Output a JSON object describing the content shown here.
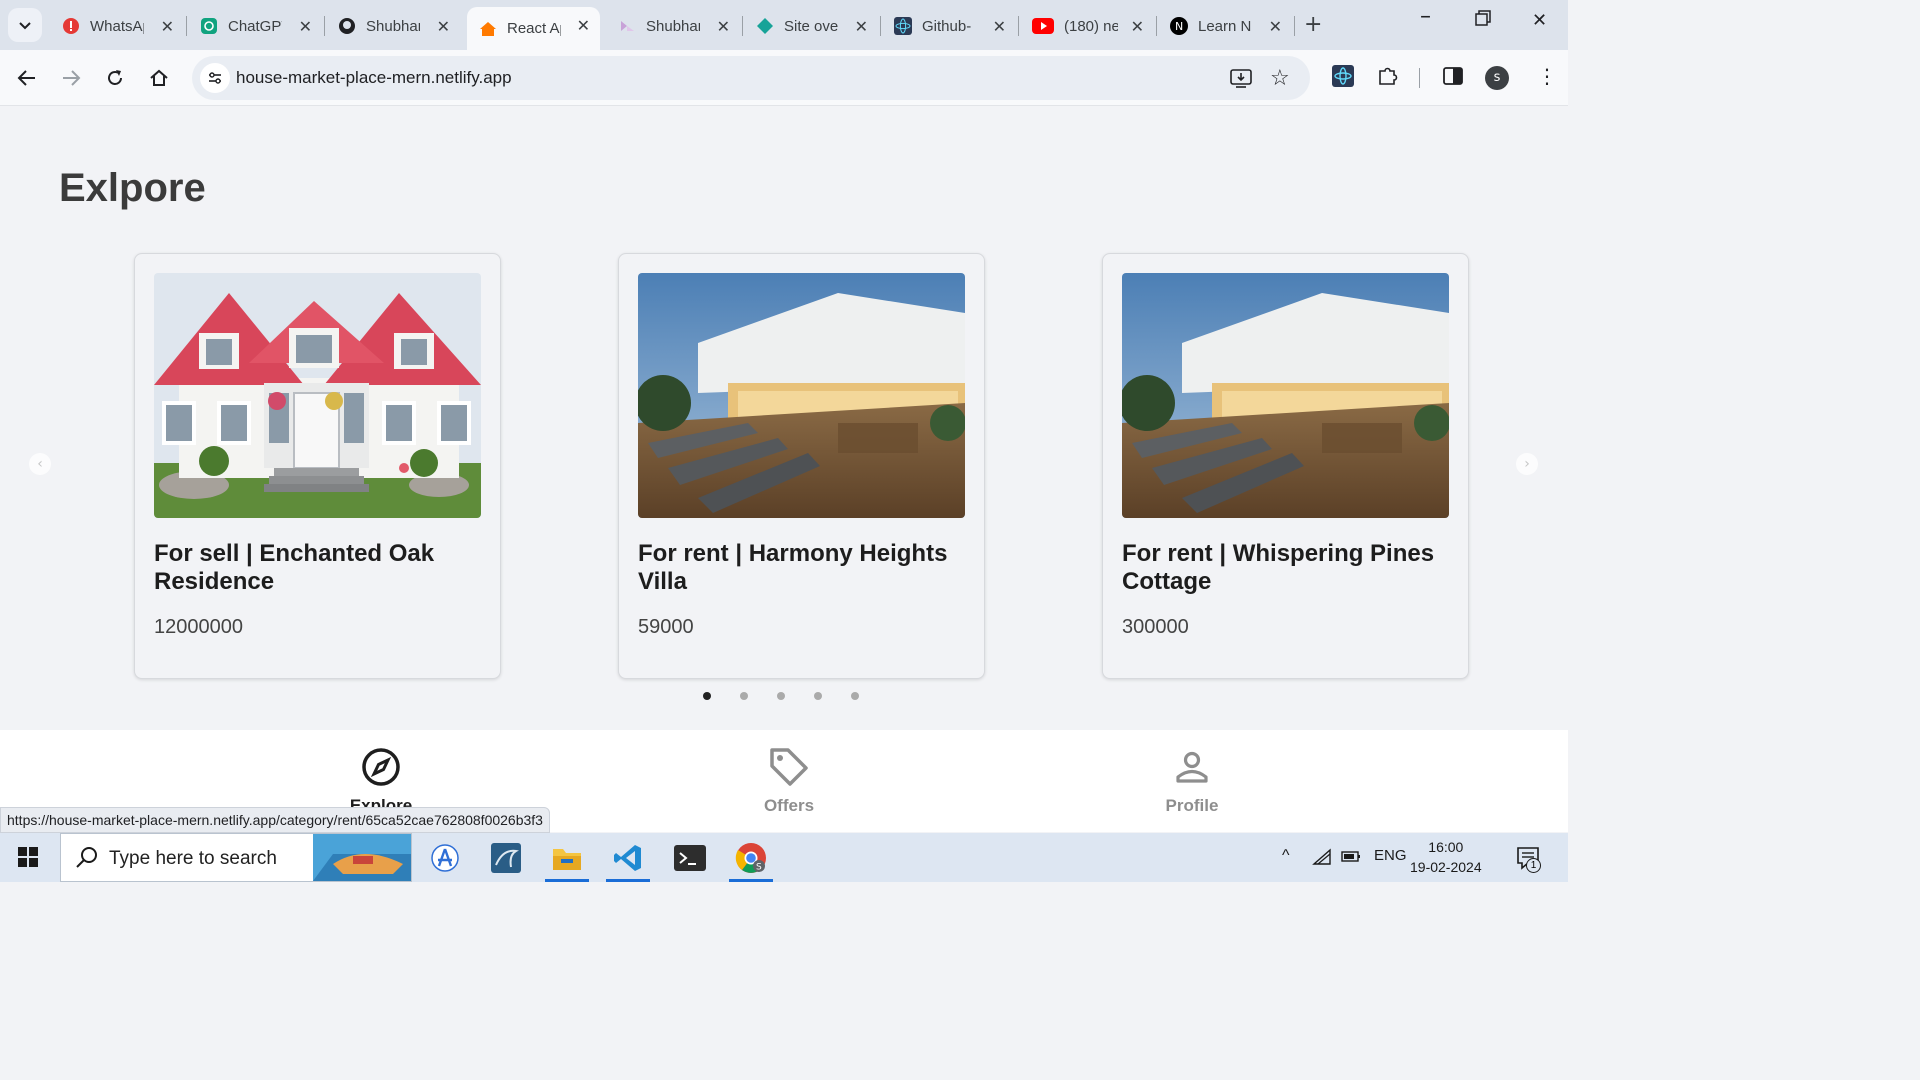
{
  "browser": {
    "tabs": [
      {
        "title": "WhatsApp",
        "icon": "whatsapp-icon",
        "color": "#e53935"
      },
      {
        "title": "ChatGPT",
        "icon": "chatgpt-icon",
        "color": "#10a37f"
      },
      {
        "title": "Shubham",
        "icon": "github-icon",
        "color": "#202124"
      },
      {
        "title": "React App",
        "icon": "house-icon",
        "color": "#ff7a00"
      },
      {
        "title": "Shubham",
        "icon": "figma-icon",
        "color": "#c8a2d8"
      },
      {
        "title": "Site overview",
        "icon": "netlify-icon",
        "color": "#17a398"
      },
      {
        "title": "Github-",
        "icon": "react-icon",
        "color": "#2b3a55"
      },
      {
        "title": "(180) ne",
        "icon": "youtube-icon",
        "color": "#ff0000"
      },
      {
        "title": "Learn N",
        "icon": "nextjs-icon",
        "color": "#000000"
      }
    ],
    "active_tab_index": 3,
    "url": "house-market-place-mern.netlify.app",
    "status_url": "https://house-market-place-mern.netlify.app/category/rent/65ca52cae762808f0026b3f3",
    "profile_initial": "s"
  },
  "page": {
    "title": "Exlpore",
    "listings": [
      {
        "title": "For sell | Enchanted Oak Residence",
        "price": "12000000",
        "image": "white-house-red-roof"
      },
      {
        "title": "For rent | Harmony Heights Villa",
        "price": "59000",
        "image": "villa-deck-lounge"
      },
      {
        "title": "For rent | Whispering Pines Cottage",
        "price": "300000",
        "image": "villa-deck-lounge"
      }
    ],
    "carousel": {
      "dot_count": 5,
      "active_dot": 0
    }
  },
  "bottom_nav": {
    "explore": "Explore",
    "offers": "Offers",
    "profile": "Profile",
    "active": "explore"
  },
  "taskbar": {
    "search_placeholder": "Type here to search",
    "language": "ENG",
    "time": "16:00",
    "date": "19-02-2024",
    "notification_count": "1"
  }
}
